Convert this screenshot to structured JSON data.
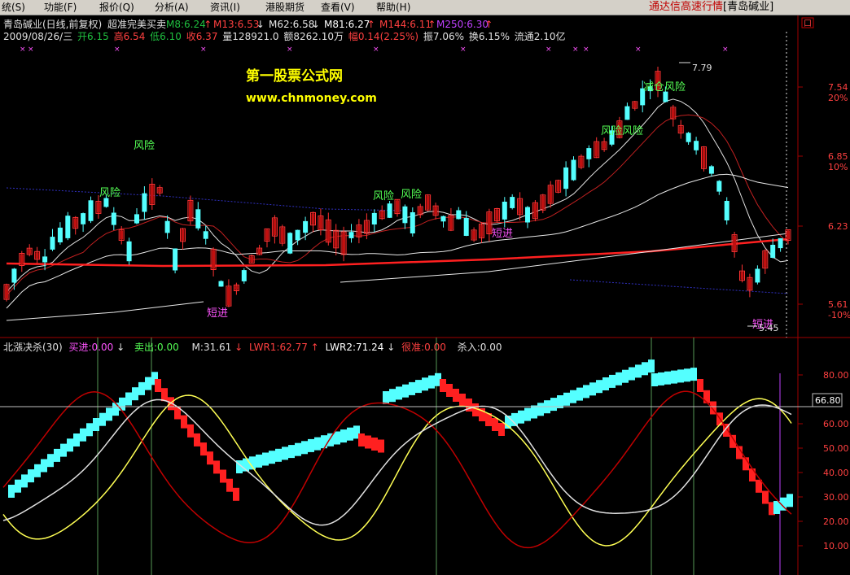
{
  "menu": {
    "items": [
      "统(S)",
      "功能(F)",
      "报价(Q)",
      "分析(A)",
      "资讯(I)",
      "港股期货",
      "查看(V)",
      "帮助(H)"
    ],
    "app_title": "通达信高速行情",
    "stock_bracket": "[青岛碱业]"
  },
  "price_panel": {
    "header": {
      "stock_name": "青岛碱业(日线,前复权)",
      "formula": "超准完美买卖",
      "ma": [
        {
          "label": "M8:6.24",
          "color": "#1fbf3f",
          "arrow": "↑"
        },
        {
          "label": "M13:6.53",
          "color": "#ff4040",
          "arrow": "↓"
        },
        {
          "label": "M62:6.58",
          "color": "#e8e8e8",
          "arrow": "↓"
        },
        {
          "label": "M81:6.27",
          "color": "#ffffff",
          "arrow": "↑"
        },
        {
          "label": "M144:6.11",
          "color": "#ff4040",
          "arrow": "↑"
        },
        {
          "label": "M250:6.30",
          "color": "#c040ff",
          "arrow": "↑"
        }
      ],
      "info_date": "2009/08/26/三",
      "info_open": "开6.15",
      "info_high": "高6.54",
      "info_low": "低6.10",
      "info_close": "收6.37",
      "info_vol": "量128921.0",
      "info_amount": "额8262.10万",
      "info_change": "幅0.14(2.25%)",
      "info_amp": "振7.06%",
      "info_turn": "换6.15%",
      "info_float": "流通2.10亿"
    },
    "watermark": {
      "line1": "第一股票公式网",
      "line2": "www.chnmoney.com"
    },
    "price_axis": [
      {
        "price": "7.54",
        "pct": "20%"
      },
      {
        "price": "6.85",
        "pct": "10%"
      },
      {
        "price": "6.23",
        "pct": ""
      },
      {
        "price": "5.61",
        "pct": "-10%"
      }
    ],
    "annotations": {
      "risk": "风险",
      "risk_risk": "风险风险",
      "reduce_risk": "减仓风险",
      "short_entry": "短进",
      "high_marker": "7.79",
      "low_marker": "5.45"
    },
    "corner_label": "口"
  },
  "indicator_panel": {
    "header": {
      "name": "北漲决杀(30)",
      "buy": "买进:0.00",
      "sell": "卖出:0.00",
      "m": "M:31.61",
      "lwr1": "LWR1:62.77",
      "lwr2": "LWR2:71.24",
      "hen": "很准:0.00",
      "kill": "杀入:0.00"
    },
    "axis": [
      "80.00",
      "60.00",
      "50.00",
      "40.00",
      "30.00",
      "20.00",
      "10.00"
    ],
    "crosshair_value": "66.80"
  },
  "colors": {
    "up": "#ff3232",
    "down": "#54ffff",
    "menu_bg": "#d4d0c8",
    "grid_red": "#a00000",
    "yellow": "#ffff54",
    "purple": "#ff54ff"
  }
}
